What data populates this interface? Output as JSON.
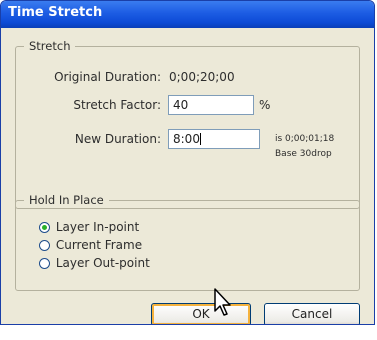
{
  "window": {
    "title": "Time Stretch"
  },
  "stretch": {
    "legend": "Stretch",
    "original_duration_label": "Original Duration:",
    "original_duration_value": "0;00;20;00",
    "stretch_factor_label": "Stretch Factor:",
    "stretch_factor_value": "40",
    "stretch_factor_unit": "%",
    "new_duration_label": "New Duration:",
    "new_duration_value": "8:00",
    "new_duration_equivalent": "is 0;00;01;18",
    "timebase": "Base 30drop"
  },
  "hold": {
    "legend": "Hold In Place",
    "options": [
      {
        "label": "Layer In-point",
        "selected": true
      },
      {
        "label": "Current Frame",
        "selected": false
      },
      {
        "label": "Layer Out-point",
        "selected": false
      }
    ]
  },
  "buttons": {
    "ok": "OK",
    "cancel": "Cancel"
  },
  "colors": {
    "titlebar": "#0d4bd6",
    "dialog_bg": "#ece9d8",
    "default_button_highlight": "#f5b23d"
  }
}
